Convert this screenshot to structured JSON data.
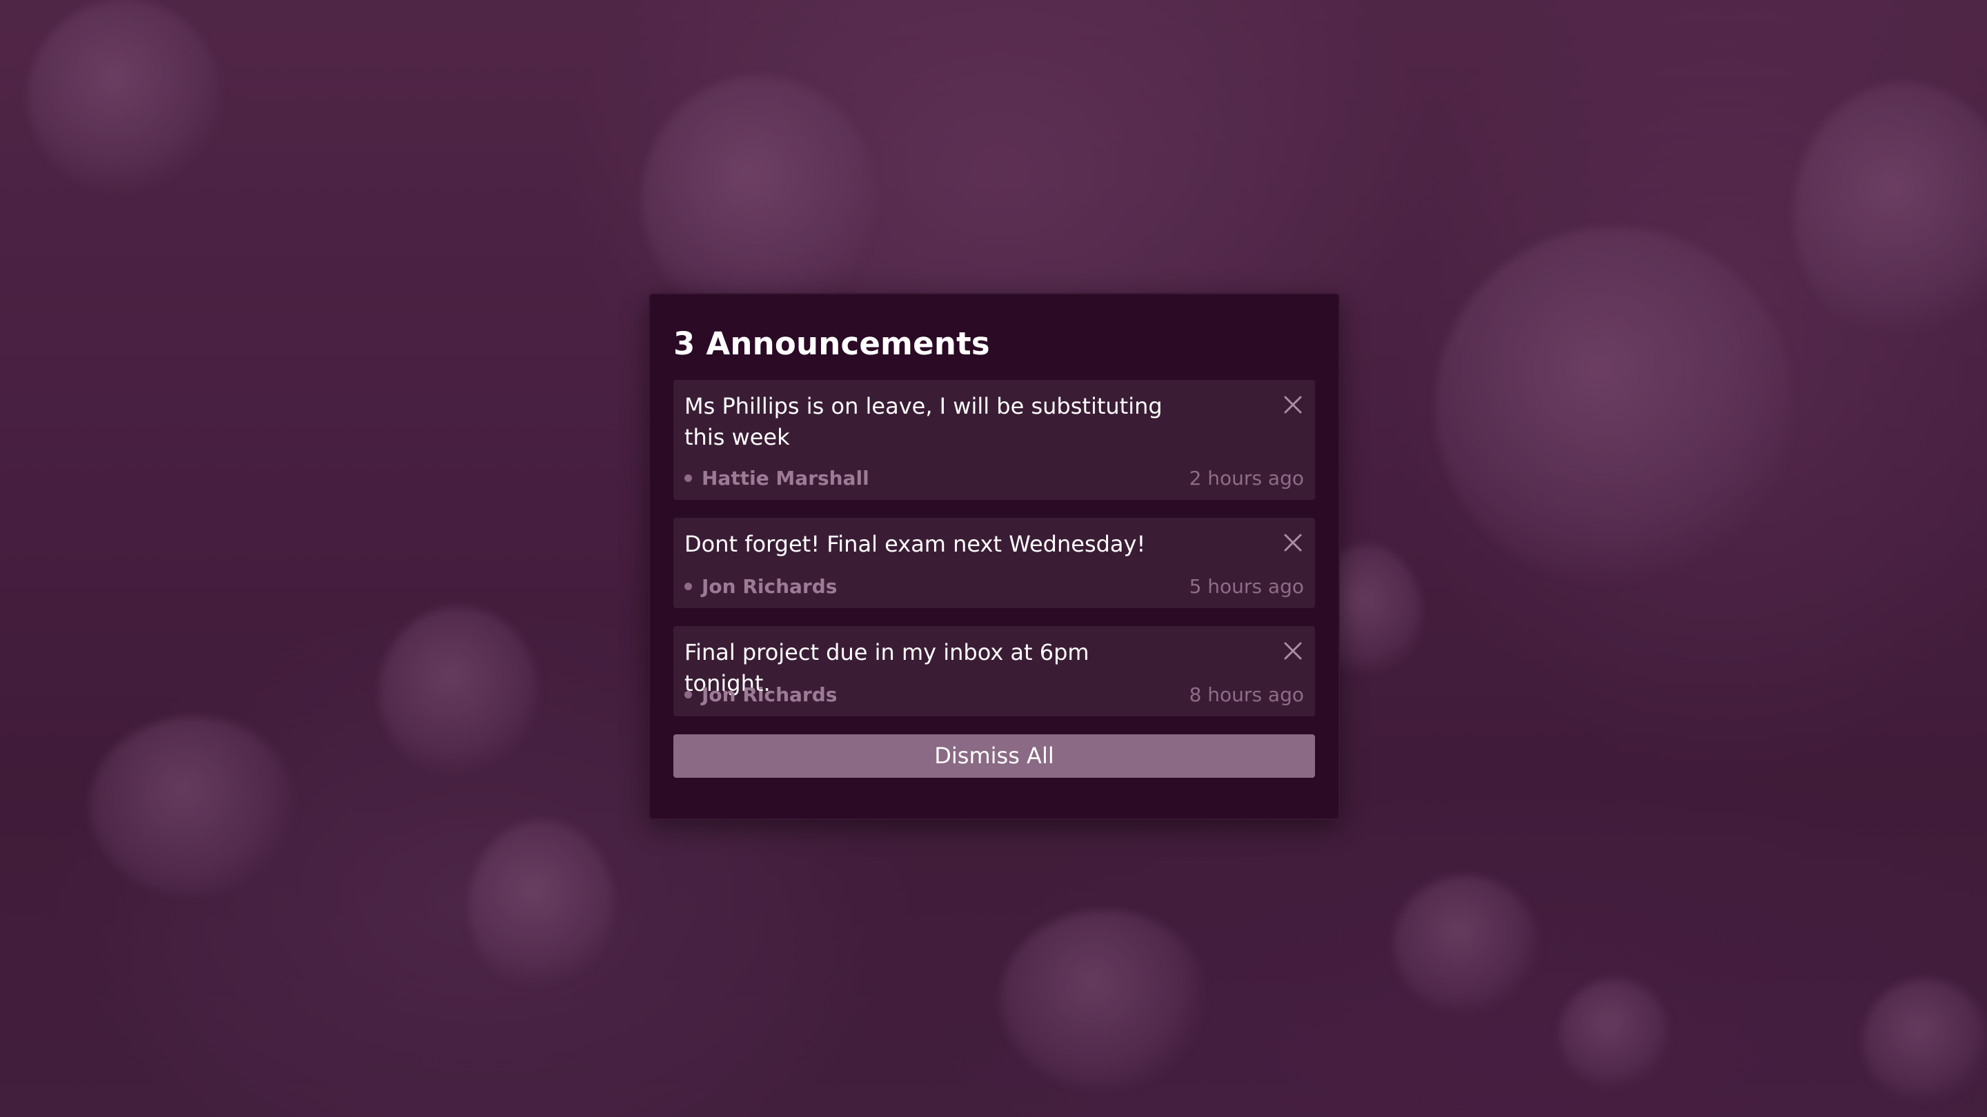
{
  "modal": {
    "title": "3 Announcements",
    "announcements": [
      {
        "message": "Ms Phillips is on leave, I will be substituting this week",
        "author": "Hattie Marshall",
        "time": "2 hours ago"
      },
      {
        "message": "Dont forget! Final exam next Wednesday!",
        "author": "Jon Richards",
        "time": "5 hours ago"
      },
      {
        "message": "Final project due in my inbox at 6pm tonight.",
        "author": "Jon Richards",
        "time": "8 hours ago"
      }
    ],
    "dismiss_all_label": "Dismiss All"
  },
  "icons": {
    "close": "close-icon",
    "author_indicator": "dot-icon"
  },
  "colors": {
    "background": "#4e2347",
    "modal_background": "#2a0a24",
    "card_background": "#3a1d35",
    "button_background": "#8a6a84",
    "muted_text": "#9d7b96",
    "text": "#ffffff"
  }
}
